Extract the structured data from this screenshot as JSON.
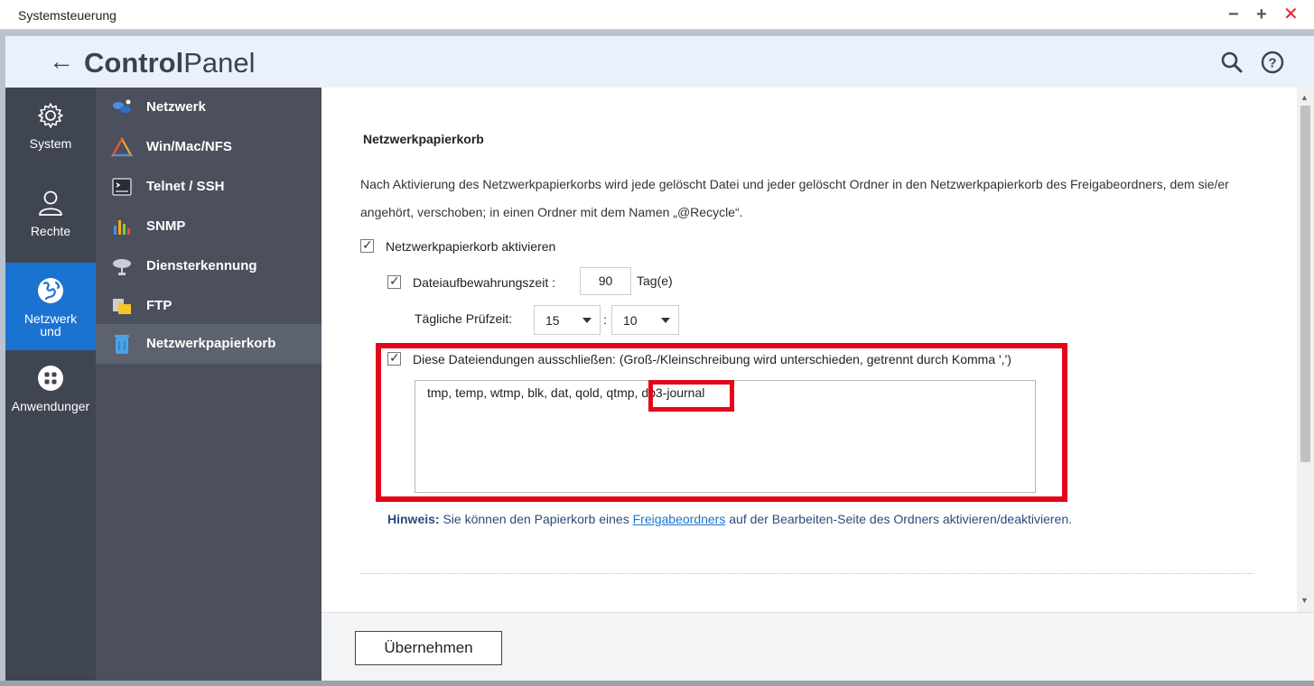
{
  "window": {
    "title": "Systemsteuerung",
    "min": "−",
    "max": "+",
    "close": "✕"
  },
  "header": {
    "title_bold": "Control",
    "title_light": "Panel",
    "back_icon": "back-arrow-icon",
    "search_icon": "search-icon",
    "help_icon": "help-icon"
  },
  "leftbar": {
    "items": [
      {
        "label": "System",
        "icon": "gear-icon"
      },
      {
        "label": "Rechte",
        "icon": "user-icon"
      },
      {
        "label": "Netzwerk und",
        "icon": "globe-icon",
        "active": true
      },
      {
        "label": "Anwendunger",
        "icon": "apps-grid-icon"
      }
    ]
  },
  "subnav": {
    "items": [
      {
        "label": "Netzwerk",
        "icon": "network-icon"
      },
      {
        "label": "Win/Mac/NFS",
        "icon": "triangle-icon"
      },
      {
        "label": "Telnet / SSH",
        "icon": "terminal-icon"
      },
      {
        "label": "SNMP",
        "icon": "bar-chart-icon"
      },
      {
        "label": "Diensterkennung",
        "icon": "satellite-dish-icon"
      },
      {
        "label": "FTP",
        "icon": "folder-transfer-icon"
      },
      {
        "label": "Netzwerkpapierkorb",
        "icon": "recycle-bin-icon",
        "active": true
      }
    ]
  },
  "main": {
    "section_title": "Netzwerkpapierkorb",
    "description": "Nach Aktivierung des Netzwerkpapierkorbs wird jede gelöscht Datei und jeder gelöscht Ordner in den Netzwerkpapierkorb des Freigabeordners, dem sie/er angehört, verschoben; in einen Ordner mit dem Namen „@Recycle“.",
    "enable_label": "Netzwerkpapierkorb aktivieren",
    "retention_label": "Dateiaufbewahrungszeit :",
    "retention_value": "90",
    "retention_unit": "Tag(e)",
    "daily_check_label": "Tägliche Prüfzeit:",
    "hour_value": "15",
    "time_sep": ":",
    "minute_value": "10",
    "exclude_label": "Diese Dateiendungen ausschließen: (Groß-/Kleinschreibung wird unterschieden, getrennt durch Komma ',')",
    "exclude_value": "tmp, temp, wtmp, blk, dat, qold, qtmp, db3-journal",
    "hint_label": "Hinweis:",
    "hint_text_1": " Sie können den Papierkorb eines ",
    "hint_link": "Freigabeordners",
    "hint_text_2": " auf der Bearbeiten-Seite des Ordners aktivieren/deaktivieren."
  },
  "footer": {
    "apply_label": "Übernehmen"
  },
  "colors": {
    "accent": "#1b73d1",
    "highlight": "#e3061a",
    "sidebar": "#404552",
    "subnav": "#4b505c"
  }
}
